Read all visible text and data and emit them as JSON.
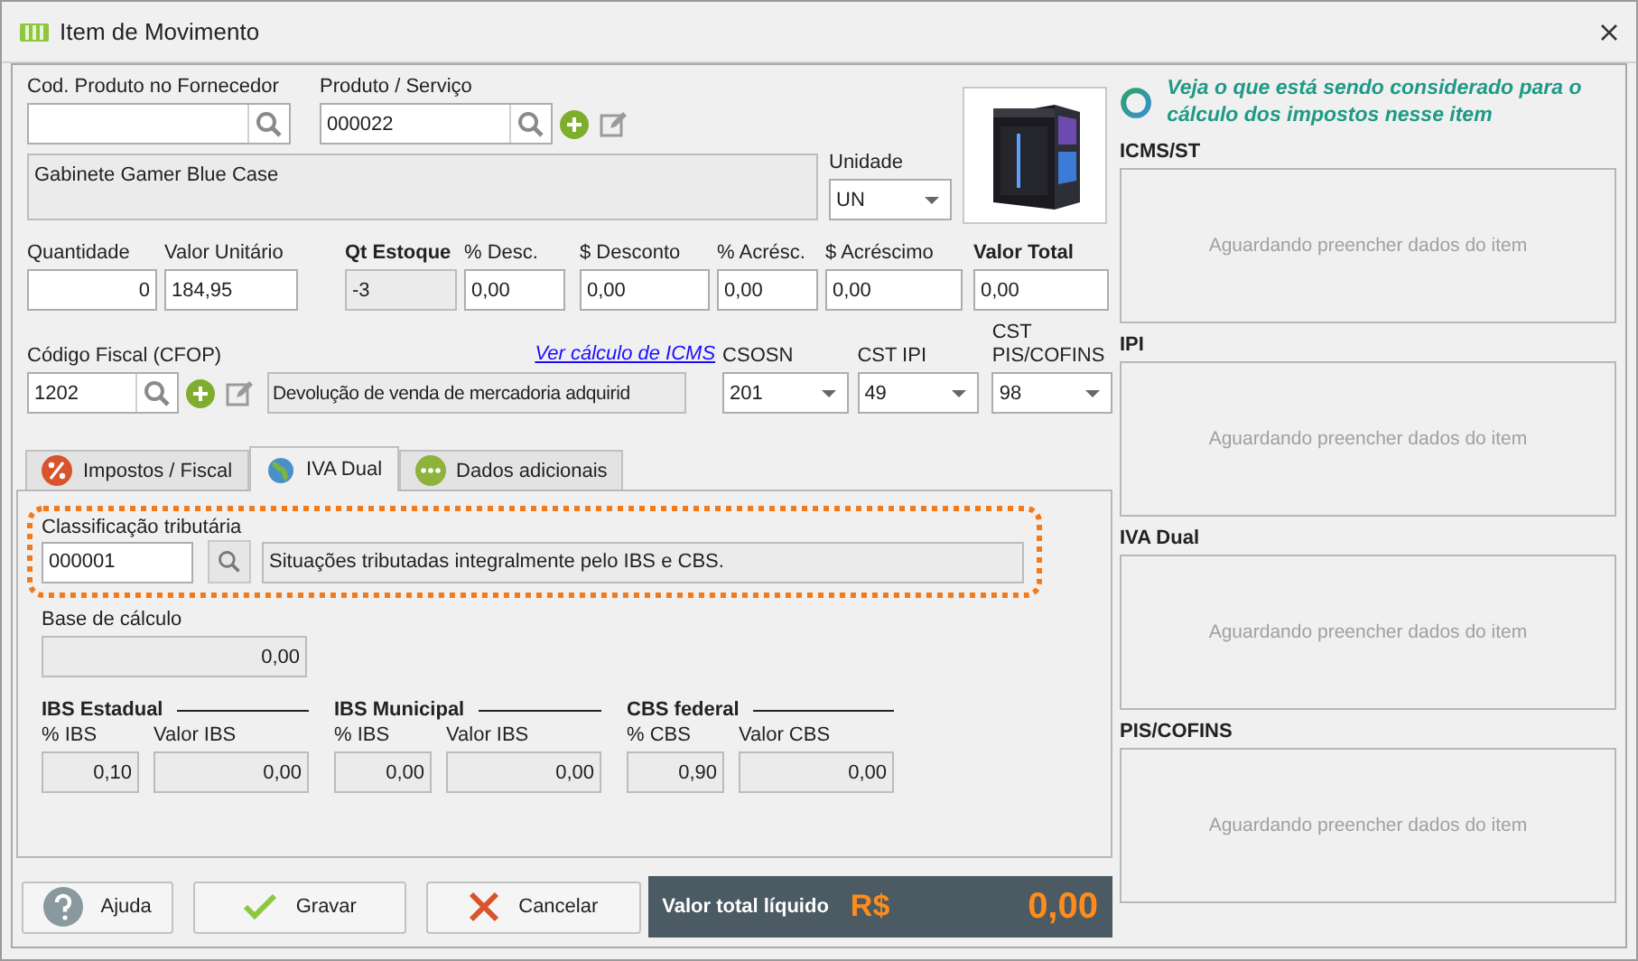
{
  "window": {
    "title": "Item de Movimento"
  },
  "product": {
    "supplier_code": {
      "label": "Cod. Produto no Fornecedor"
    },
    "product": {
      "label": "Produto / Serviço",
      "value": "000022"
    },
    "description": "Gabinete Gamer Blue Case",
    "unit": {
      "label": "Unidade",
      "value": "UN"
    }
  },
  "values": [
    {
      "label": "Quantidade",
      "value": "0",
      "kind": "input",
      "strong": false
    },
    {
      "label": "Valor Unitário",
      "value": "184,95",
      "kind": "input",
      "strong": false
    },
    {
      "label": "Qt Estoque",
      "value": "-3",
      "kind": "readonly",
      "strong": true
    },
    {
      "label": "% Desc.",
      "value": "0,00",
      "kind": "input",
      "strong": false
    },
    {
      "label": "$ Desconto",
      "value": "0,00",
      "kind": "input",
      "strong": false
    },
    {
      "label": "% Acrésc.",
      "value": "0,00",
      "kind": "input",
      "strong": false
    },
    {
      "label": "$ Acréscimo",
      "value": "0,00",
      "kind": "input",
      "strong": false
    },
    {
      "label": "Valor Total",
      "value": "0,00",
      "kind": "input",
      "strong": true
    }
  ],
  "fiscal": {
    "cfop": {
      "label": "Código Fiscal (CFOP)",
      "value": "1202",
      "description": "Devolução de venda de mercadoria adquirid"
    },
    "link": "Ver cálculo de ICMS",
    "selects": [
      {
        "label": "CSOSN",
        "value": "201"
      },
      {
        "label": "CST IPI",
        "value": "49"
      },
      {
        "label": "CST PIS/COFINS",
        "value": "98"
      }
    ]
  },
  "tabs": [
    {
      "label": "Impostos / Fiscal",
      "selected": false
    },
    {
      "label": "IVA Dual",
      "selected": true
    },
    {
      "label": "Dados adicionais",
      "selected": false
    }
  ],
  "iva_dual": {
    "classification": {
      "label": "Classificação tributária",
      "value": "000001",
      "description": "Situações tributadas integralmente pelo IBS e CBS."
    },
    "base": {
      "label": "Base de cálculo",
      "value": "0,00"
    },
    "groups": [
      {
        "title": "IBS Estadual",
        "rate_label": "% IBS",
        "rate": "0,10",
        "amount_label": "Valor IBS",
        "amount": "0,00"
      },
      {
        "title": "IBS Municipal",
        "rate_label": "% IBS",
        "rate": "0,00",
        "amount_label": "Valor IBS",
        "amount": "0,00"
      },
      {
        "title": "CBS federal",
        "rate_label": "% CBS",
        "rate": "0,90",
        "amount_label": "Valor CBS",
        "amount": "0,00"
      }
    ]
  },
  "buttons": [
    {
      "label": "Ajuda"
    },
    {
      "label": "Gravar"
    },
    {
      "label": "Cancelar"
    }
  ],
  "total": {
    "label": "Valor total líquido",
    "currency": "R$",
    "value": "0,00"
  },
  "side_panel": {
    "heading": "Veja o que está sendo considerado para o cálculo dos impostos nesse item",
    "sections": [
      {
        "title": "ICMS/ST",
        "message": "Aguardando preencher dados do item"
      },
      {
        "title": "IPI",
        "message": "Aguardando preencher dados do item"
      },
      {
        "title": "IVA Dual",
        "message": "Aguardando preencher dados do item"
      },
      {
        "title": "PIS/COFINS",
        "message": "Aguardando preencher dados do item"
      }
    ]
  }
}
